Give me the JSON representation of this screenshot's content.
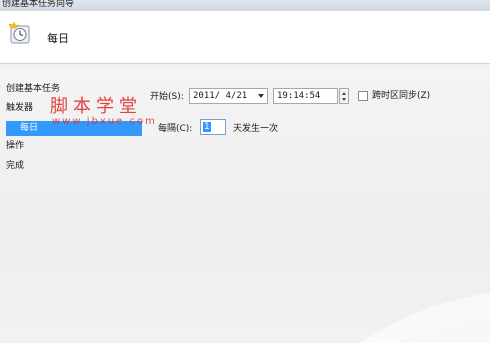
{
  "window": {
    "title": "创建基本任务向导"
  },
  "header": {
    "icon": "task-clock-icon",
    "title": "每日"
  },
  "nav": {
    "items": [
      {
        "label": "创建基本任务",
        "selected": false
      },
      {
        "label": "触发器",
        "selected": false
      },
      {
        "label": "每日",
        "selected": true
      },
      {
        "label": "操作",
        "selected": false
      },
      {
        "label": "完成",
        "selected": false
      }
    ]
  },
  "form": {
    "start_label": "开始(S):",
    "start_date": "2011/  4/21",
    "start_time": "19:14:54",
    "sync_label": "跨时区同步(Z)",
    "sync_checked": false,
    "recur_label": "每隔(C):",
    "recur_value": "1",
    "recur_suffix": "天发生一次"
  },
  "watermark": {
    "text": "脚本学堂",
    "url": "www.jbxue.com"
  },
  "colors": {
    "selection": "#3399ff",
    "watermark": "#e0302a",
    "header_bg": "#ffffff",
    "body_bg": "#efefef"
  }
}
